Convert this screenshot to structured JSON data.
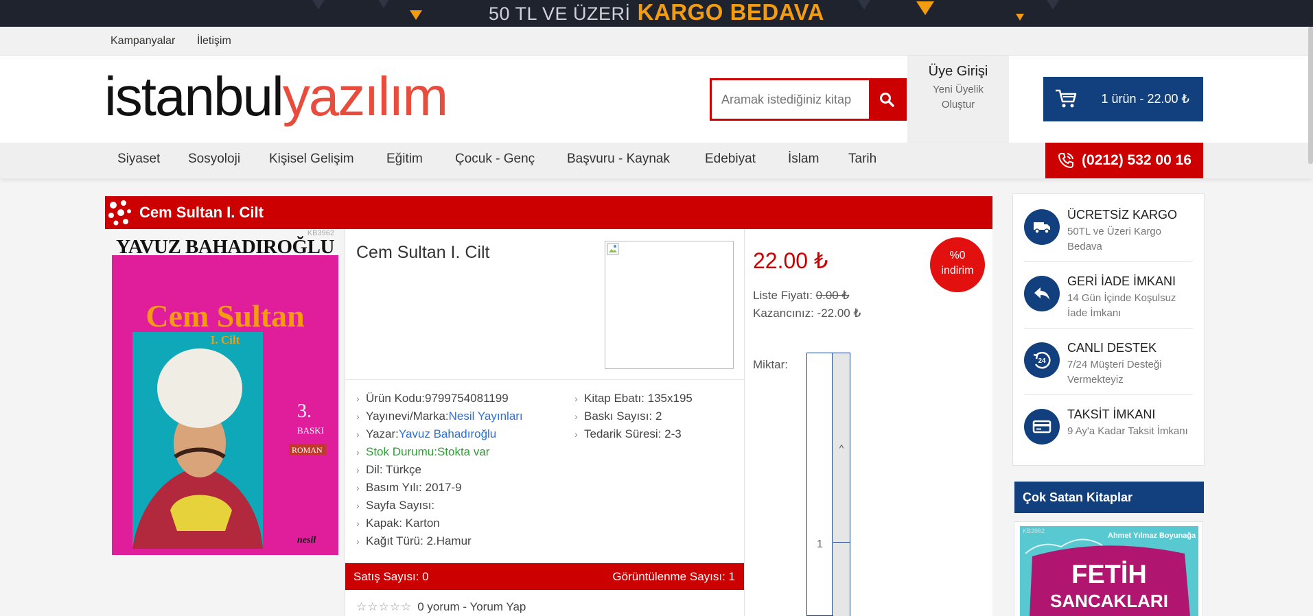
{
  "promo": {
    "text_small": "50 TL VE ÜZERİ",
    "text_big": "KARGO BEDAVA"
  },
  "subnav": {
    "items": [
      "Kampanyalar",
      "İletişim"
    ]
  },
  "header": {
    "logo_part1": "istanbul",
    "logo_part2": "yazılım",
    "search_placeholder": "Aramak istediğiniz kitap",
    "member_title": "Üye Girişi",
    "member_sub1": "Yeni Üyelik",
    "member_sub2": "Oluştur",
    "cart_label": "1 ürün - 22.00 ₺"
  },
  "categories": [
    "Siyaset",
    "Sosyoloji",
    "Kişisel Gelişim",
    "Eğitim",
    "Çocuk - Genç",
    "Başvuru - Kaynak",
    "Edebiyat",
    "İslam",
    "Tarih"
  ],
  "phone": "(0212) 532 00 16",
  "product": {
    "title_bar": "Cem Sultan I. Cilt",
    "name": "Cem Sultan I. Cilt",
    "cover": {
      "catalog_no": "KB3962",
      "author": "YAVUZ BAHADIROĞLU",
      "title": "Cem Sultan",
      "volume": "I. Cilt",
      "edition_num": "3.",
      "edition_word": "BASKI",
      "genre": "ROMAN",
      "publisher_mark": "nesil"
    },
    "specs_left": [
      {
        "label": "Ürün Kodu:",
        "value": "9799754081199"
      },
      {
        "label": "Yayınevi/Marka:",
        "value": "Nesil Yayınları"
      },
      {
        "label": "Yazar:",
        "value": "Yavuz Bahadıroğlu"
      },
      {
        "label": "Stok Durumu:",
        "value": "Stokta var"
      },
      {
        "label": "Dil: ",
        "value": "Türkçe"
      },
      {
        "label": "Basım Yılı: ",
        "value": "2017-9"
      },
      {
        "label": "Sayfa Sayısı:",
        "value": ""
      },
      {
        "label": "Kapak: ",
        "value": "Karton"
      },
      {
        "label": "Kağıt Türü: ",
        "value": "2.Hamur"
      }
    ],
    "specs_right": [
      {
        "label": "Kitap Ebatı: ",
        "value": "135x195"
      },
      {
        "label": "Baskı Sayısı: ",
        "value": "2"
      },
      {
        "label": "Tedarik Süresi: ",
        "value": "2-3"
      }
    ],
    "sales_label": "Satış Sayısı: 0",
    "views_label": "Görüntülenme Sayısı: 1",
    "stars": "☆☆☆☆☆",
    "review_count": "0 yorum",
    "review_sep": " - ",
    "review_link": "Yorum Yap",
    "price": "22.00 ₺",
    "discount_line1": "%0",
    "discount_line2": "indirim",
    "list_price_label": "Liste Fiyatı: ",
    "list_price_value": "0.00 ₺",
    "savings": "Kazancınız: -22.00 ₺",
    "quantity_label": "Miktar:",
    "quantity_value": "1"
  },
  "info_boxes": [
    {
      "title": "ÜCRETSİZ KARGO",
      "desc": "50TL ve Üzeri Kargo Bedava",
      "icon": "truck-icon"
    },
    {
      "title": "GERİ İADE İMKANI",
      "desc": "14 Gün İçinde Koşulsuz İade İmkanı",
      "icon": "return-icon"
    },
    {
      "title": "CANLI DESTEK",
      "desc": "7/24 Müşteri Desteği Vermekteyiz",
      "icon": "support-24-icon"
    },
    {
      "title": "TAKSİT İMKANI",
      "desc": "9 Ay'a Kadar Taksit İmkanı",
      "icon": "credit-card-icon"
    }
  ],
  "bestsellers": {
    "title": "Çok Satan Kitaplar",
    "first_book": {
      "catalog_no": "KB3962",
      "author": "Ahmet Yılmaz Boyunağa",
      "title_line1": "FETİH",
      "title_line2": "SANCAKLARI"
    }
  },
  "colors": {
    "brand_red": "#cc0000",
    "brand_blue": "#12407e",
    "accent_orange": "#f39c12",
    "link_blue": "#2a6fdb",
    "stock_green": "#2e9e35"
  }
}
